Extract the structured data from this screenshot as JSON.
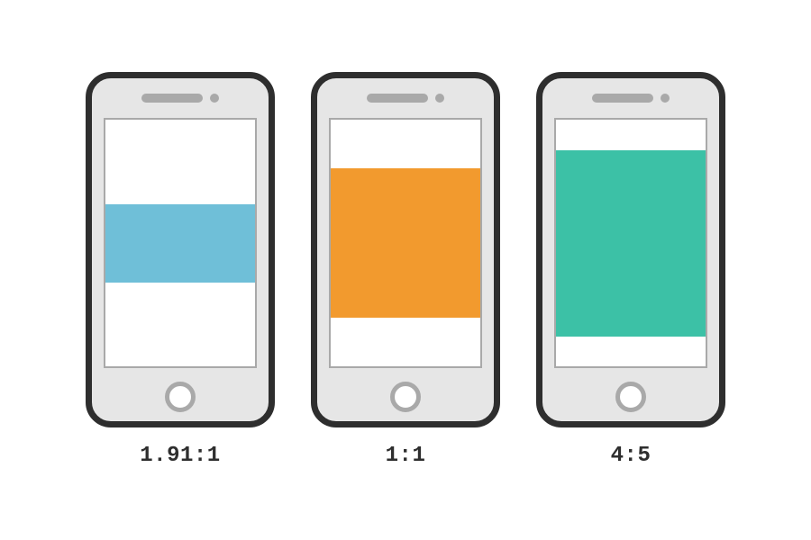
{
  "phones": [
    {
      "ratio_label": "1.91:1",
      "semantic_name": "phone-landscape",
      "ratio_w": 1.91,
      "ratio_h": 1,
      "color": "#6fbfd8"
    },
    {
      "ratio_label": "1:1",
      "semantic_name": "phone-square",
      "ratio_w": 1,
      "ratio_h": 1,
      "color": "#f29a2e"
    },
    {
      "ratio_label": "4:5",
      "semantic_name": "phone-portrait",
      "ratio_w": 4,
      "ratio_h": 5,
      "color": "#3cc1a6"
    }
  ]
}
